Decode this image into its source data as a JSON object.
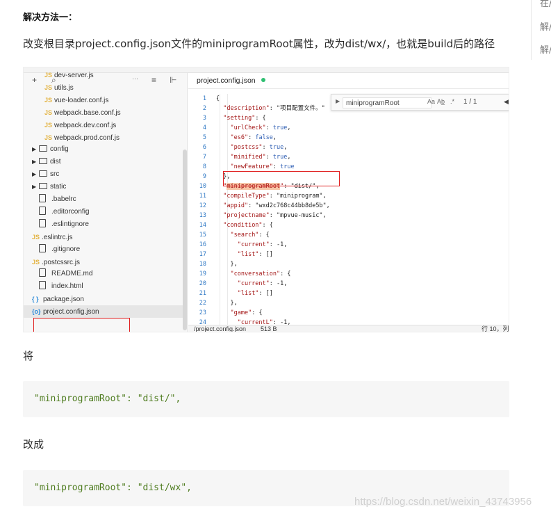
{
  "article": {
    "heading": "解决方法一：",
    "instruction": "改变根目录project.config.json文件的miniprogramRoot属性，改为dist/wx/，也就是build后的路径",
    "label_change_from": "将",
    "code_before": "\"miniprogramRoot\": \"dist/\",",
    "label_change_to": "改成",
    "code_after": "\"miniprogramRoot\": \"dist/wx\","
  },
  "side_links": [
    "在/",
    "解/",
    "解/"
  ],
  "watermark": "https://blog.csdn.net/weixin_43743956",
  "screenshot": {
    "toolbar": {
      "add": "+",
      "search": "⌕",
      "more": "···",
      "sort": "≡",
      "collapse": "⊩"
    },
    "tree": [
      {
        "type": "js",
        "name": "dev-server.js",
        "indent": 1
      },
      {
        "type": "js",
        "name": "utils.js",
        "indent": 1
      },
      {
        "type": "js",
        "name": "vue-loader.conf.js",
        "indent": 1
      },
      {
        "type": "js",
        "name": "webpack.base.conf.js",
        "indent": 1
      },
      {
        "type": "js",
        "name": "webpack.dev.conf.js",
        "indent": 1
      },
      {
        "type": "js",
        "name": "webpack.prod.conf.js",
        "indent": 1
      },
      {
        "type": "folder",
        "name": "config",
        "indent": 0
      },
      {
        "type": "folder",
        "name": "dist",
        "indent": 0
      },
      {
        "type": "folder",
        "name": "src",
        "indent": 0
      },
      {
        "type": "folder",
        "name": "static",
        "indent": 0
      },
      {
        "type": "file",
        "name": ".babelrc",
        "indent": 0
      },
      {
        "type": "file",
        "name": ".editorconfig",
        "indent": 0
      },
      {
        "type": "file",
        "name": ".eslintignore",
        "indent": 0
      },
      {
        "type": "js",
        "name": ".eslintrc.js",
        "indent": 0
      },
      {
        "type": "file",
        "name": ".gitignore",
        "indent": 0
      },
      {
        "type": "js",
        "name": ".postcssrc.js",
        "indent": 0
      },
      {
        "type": "file",
        "name": "README.md",
        "indent": 0
      },
      {
        "type": "file",
        "name": "index.html",
        "indent": 0
      },
      {
        "type": "json",
        "name": "package.json",
        "indent": 0
      },
      {
        "type": "json",
        "name": "project.config.json",
        "indent": 0,
        "selected": true
      }
    ],
    "tab": {
      "label": "project.config.json"
    },
    "find": {
      "value": "miniprogramRoot",
      "opt_case": "Aa",
      "opt_word": "Ab̲",
      "opt_regex": ".*",
      "count": "1 / 1",
      "prev": "◀"
    },
    "code_lines": [
      {
        "n": "1",
        "text": "{"
      },
      {
        "n": "2",
        "text": "  \"description\": \"项目配置文件。\""
      },
      {
        "n": "3",
        "text": "  \"setting\": {"
      },
      {
        "n": "4",
        "text": "    \"urlCheck\": true,"
      },
      {
        "n": "5",
        "text": "    \"es6\": false,"
      },
      {
        "n": "6",
        "text": "    \"postcss\": true,"
      },
      {
        "n": "7",
        "text": "    \"minified\": true,"
      },
      {
        "n": "8",
        "text": "    \"newFeature\": true"
      },
      {
        "n": "9",
        "text": "  },"
      },
      {
        "n": "10",
        "text": "  \"miniprogramRoot\": \"dist/\","
      },
      {
        "n": "11",
        "text": "  \"compileType\": \"miniprogram\","
      },
      {
        "n": "12",
        "text": "  \"appid\": \"wxd2c768c44bb8de5b\","
      },
      {
        "n": "13",
        "text": "  \"projectname\": \"mpvue-music\","
      },
      {
        "n": "14",
        "text": "  \"condition\": {"
      },
      {
        "n": "15",
        "text": "    \"search\": {"
      },
      {
        "n": "16",
        "text": "      \"current\": -1,"
      },
      {
        "n": "17",
        "text": "      \"list\": []"
      },
      {
        "n": "18",
        "text": "    },"
      },
      {
        "n": "19",
        "text": "    \"conversation\": {"
      },
      {
        "n": "20",
        "text": "      \"current\": -1,"
      },
      {
        "n": "21",
        "text": "      \"list\": []"
      },
      {
        "n": "22",
        "text": "    },"
      },
      {
        "n": "23",
        "text": "    \"game\": {"
      },
      {
        "n": "24",
        "text": "      \"currentL\": -1,"
      }
    ],
    "status": {
      "path": "/project.config.json",
      "size": "513 B",
      "position": "行 10，列"
    }
  }
}
